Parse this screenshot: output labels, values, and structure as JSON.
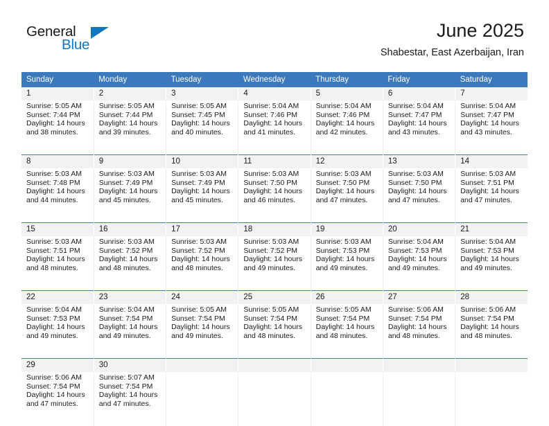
{
  "brand": {
    "word_general": "General",
    "word_blue": "Blue",
    "logo_icon": "triangle-logo-icon",
    "accent_color": "#1277bf"
  },
  "header": {
    "title": "June 2025",
    "location": "Shabestar, East Azerbaijan, Iran"
  },
  "theme": {
    "header_blue": "#3c78bc",
    "daynum_gray": "#f2f2f2",
    "text_color": "#1a1a1a"
  },
  "weekday_headers": [
    "Sunday",
    "Monday",
    "Tuesday",
    "Wednesday",
    "Thursday",
    "Friday",
    "Saturday"
  ],
  "weeks": [
    {
      "days": [
        {
          "num": "1",
          "sunrise": "Sunrise: 5:05 AM",
          "sunset": "Sunset: 7:44 PM",
          "daylight_1": "Daylight: 14 hours",
          "daylight_2": "and 38 minutes."
        },
        {
          "num": "2",
          "sunrise": "Sunrise: 5:05 AM",
          "sunset": "Sunset: 7:44 PM",
          "daylight_1": "Daylight: 14 hours",
          "daylight_2": "and 39 minutes."
        },
        {
          "num": "3",
          "sunrise": "Sunrise: 5:05 AM",
          "sunset": "Sunset: 7:45 PM",
          "daylight_1": "Daylight: 14 hours",
          "daylight_2": "and 40 minutes."
        },
        {
          "num": "4",
          "sunrise": "Sunrise: 5:04 AM",
          "sunset": "Sunset: 7:46 PM",
          "daylight_1": "Daylight: 14 hours",
          "daylight_2": "and 41 minutes."
        },
        {
          "num": "5",
          "sunrise": "Sunrise: 5:04 AM",
          "sunset": "Sunset: 7:46 PM",
          "daylight_1": "Daylight: 14 hours",
          "daylight_2": "and 42 minutes."
        },
        {
          "num": "6",
          "sunrise": "Sunrise: 5:04 AM",
          "sunset": "Sunset: 7:47 PM",
          "daylight_1": "Daylight: 14 hours",
          "daylight_2": "and 43 minutes."
        },
        {
          "num": "7",
          "sunrise": "Sunrise: 5:04 AM",
          "sunset": "Sunset: 7:47 PM",
          "daylight_1": "Daylight: 14 hours",
          "daylight_2": "and 43 minutes."
        }
      ]
    },
    {
      "days": [
        {
          "num": "8",
          "sunrise": "Sunrise: 5:03 AM",
          "sunset": "Sunset: 7:48 PM",
          "daylight_1": "Daylight: 14 hours",
          "daylight_2": "and 44 minutes."
        },
        {
          "num": "9",
          "sunrise": "Sunrise: 5:03 AM",
          "sunset": "Sunset: 7:49 PM",
          "daylight_1": "Daylight: 14 hours",
          "daylight_2": "and 45 minutes."
        },
        {
          "num": "10",
          "sunrise": "Sunrise: 5:03 AM",
          "sunset": "Sunset: 7:49 PM",
          "daylight_1": "Daylight: 14 hours",
          "daylight_2": "and 45 minutes."
        },
        {
          "num": "11",
          "sunrise": "Sunrise: 5:03 AM",
          "sunset": "Sunset: 7:50 PM",
          "daylight_1": "Daylight: 14 hours",
          "daylight_2": "and 46 minutes."
        },
        {
          "num": "12",
          "sunrise": "Sunrise: 5:03 AM",
          "sunset": "Sunset: 7:50 PM",
          "daylight_1": "Daylight: 14 hours",
          "daylight_2": "and 47 minutes."
        },
        {
          "num": "13",
          "sunrise": "Sunrise: 5:03 AM",
          "sunset": "Sunset: 7:50 PM",
          "daylight_1": "Daylight: 14 hours",
          "daylight_2": "and 47 minutes."
        },
        {
          "num": "14",
          "sunrise": "Sunrise: 5:03 AM",
          "sunset": "Sunset: 7:51 PM",
          "daylight_1": "Daylight: 14 hours",
          "daylight_2": "and 47 minutes."
        }
      ]
    },
    {
      "days": [
        {
          "num": "15",
          "sunrise": "Sunrise: 5:03 AM",
          "sunset": "Sunset: 7:51 PM",
          "daylight_1": "Daylight: 14 hours",
          "daylight_2": "and 48 minutes."
        },
        {
          "num": "16",
          "sunrise": "Sunrise: 5:03 AM",
          "sunset": "Sunset: 7:52 PM",
          "daylight_1": "Daylight: 14 hours",
          "daylight_2": "and 48 minutes."
        },
        {
          "num": "17",
          "sunrise": "Sunrise: 5:03 AM",
          "sunset": "Sunset: 7:52 PM",
          "daylight_1": "Daylight: 14 hours",
          "daylight_2": "and 48 minutes."
        },
        {
          "num": "18",
          "sunrise": "Sunrise: 5:03 AM",
          "sunset": "Sunset: 7:52 PM",
          "daylight_1": "Daylight: 14 hours",
          "daylight_2": "and 49 minutes."
        },
        {
          "num": "19",
          "sunrise": "Sunrise: 5:03 AM",
          "sunset": "Sunset: 7:53 PM",
          "daylight_1": "Daylight: 14 hours",
          "daylight_2": "and 49 minutes."
        },
        {
          "num": "20",
          "sunrise": "Sunrise: 5:04 AM",
          "sunset": "Sunset: 7:53 PM",
          "daylight_1": "Daylight: 14 hours",
          "daylight_2": "and 49 minutes."
        },
        {
          "num": "21",
          "sunrise": "Sunrise: 5:04 AM",
          "sunset": "Sunset: 7:53 PM",
          "daylight_1": "Daylight: 14 hours",
          "daylight_2": "and 49 minutes."
        }
      ]
    },
    {
      "days": [
        {
          "num": "22",
          "sunrise": "Sunrise: 5:04 AM",
          "sunset": "Sunset: 7:53 PM",
          "daylight_1": "Daylight: 14 hours",
          "daylight_2": "and 49 minutes."
        },
        {
          "num": "23",
          "sunrise": "Sunrise: 5:04 AM",
          "sunset": "Sunset: 7:54 PM",
          "daylight_1": "Daylight: 14 hours",
          "daylight_2": "and 49 minutes."
        },
        {
          "num": "24",
          "sunrise": "Sunrise: 5:05 AM",
          "sunset": "Sunset: 7:54 PM",
          "daylight_1": "Daylight: 14 hours",
          "daylight_2": "and 49 minutes."
        },
        {
          "num": "25",
          "sunrise": "Sunrise: 5:05 AM",
          "sunset": "Sunset: 7:54 PM",
          "daylight_1": "Daylight: 14 hours",
          "daylight_2": "and 48 minutes."
        },
        {
          "num": "26",
          "sunrise": "Sunrise: 5:05 AM",
          "sunset": "Sunset: 7:54 PM",
          "daylight_1": "Daylight: 14 hours",
          "daylight_2": "and 48 minutes."
        },
        {
          "num": "27",
          "sunrise": "Sunrise: 5:06 AM",
          "sunset": "Sunset: 7:54 PM",
          "daylight_1": "Daylight: 14 hours",
          "daylight_2": "and 48 minutes."
        },
        {
          "num": "28",
          "sunrise": "Sunrise: 5:06 AM",
          "sunset": "Sunset: 7:54 PM",
          "daylight_1": "Daylight: 14 hours",
          "daylight_2": "and 48 minutes."
        }
      ]
    },
    {
      "days": [
        {
          "num": "29",
          "sunrise": "Sunrise: 5:06 AM",
          "sunset": "Sunset: 7:54 PM",
          "daylight_1": "Daylight: 14 hours",
          "daylight_2": "and 47 minutes."
        },
        {
          "num": "30",
          "sunrise": "Sunrise: 5:07 AM",
          "sunset": "Sunset: 7:54 PM",
          "daylight_1": "Daylight: 14 hours",
          "daylight_2": "and 47 minutes."
        },
        {
          "num": "",
          "sunrise": "",
          "sunset": "",
          "daylight_1": "",
          "daylight_2": ""
        },
        {
          "num": "",
          "sunrise": "",
          "sunset": "",
          "daylight_1": "",
          "daylight_2": ""
        },
        {
          "num": "",
          "sunrise": "",
          "sunset": "",
          "daylight_1": "",
          "daylight_2": ""
        },
        {
          "num": "",
          "sunrise": "",
          "sunset": "",
          "daylight_1": "",
          "daylight_2": ""
        },
        {
          "num": "",
          "sunrise": "",
          "sunset": "",
          "daylight_1": "",
          "daylight_2": ""
        }
      ]
    }
  ]
}
